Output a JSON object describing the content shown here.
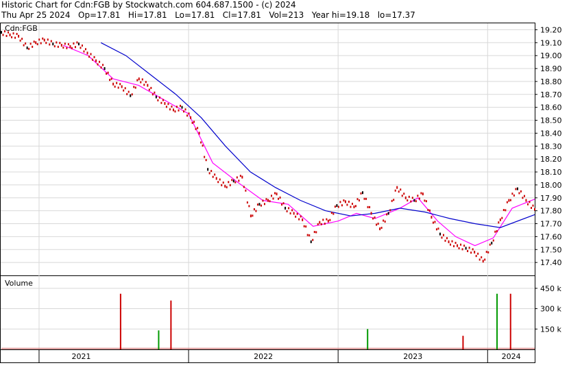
{
  "header": {
    "title": "Historic Chart for Cdn:FGB by Stockwatch.com 604.687.1500 - (c) 2024",
    "stats": "Thu Apr 25 2024   Op=17.81   Hi=17.81   Lo=17.81   Cl=17.81   Vol=213   Year hi=19.18   lo=17.37"
  },
  "chart_data": [
    {
      "type": "line",
      "subtype": "price-ohlc-with-moving-averages",
      "symbol_label": "Cdn:FGB",
      "y_axis_side": "right",
      "ylim": [
        17.3,
        19.25
      ],
      "yticks": [
        "19.20",
        "19.10",
        "19.00",
        "18.90",
        "18.80",
        "18.70",
        "18.60",
        "18.50",
        "18.40",
        "18.30",
        "18.20",
        "18.10",
        "18.00",
        "17.90",
        "17.80",
        "17.70",
        "17.60",
        "17.50",
        "17.40"
      ],
      "x_start": "2020-10-01",
      "x_end": "2024-04-25",
      "x_labels": [
        {
          "label": "2021",
          "date": "2021-01-01"
        },
        {
          "label": "2022",
          "date": "2022-01-01"
        },
        {
          "label": "2023",
          "date": "2023-01-01"
        },
        {
          "label": "2024",
          "date": "2024-01-01"
        }
      ],
      "grid": true,
      "colors": {
        "price": "#cc0000",
        "price_alt": "#000000",
        "ma_short": "#ff00ff",
        "ma_long": "#0000cc"
      },
      "series": [
        {
          "key": "price",
          "points": [
            [
              "2020-10-01",
              19.18
            ],
            [
              "2020-10-22",
              19.16
            ],
            [
              "2020-11-12",
              19.15
            ],
            [
              "2020-12-03",
              19.06
            ],
            [
              "2020-12-24",
              19.1
            ],
            [
              "2021-01-14",
              19.12
            ],
            [
              "2021-02-04",
              19.09
            ],
            [
              "2021-02-25",
              19.08
            ],
            [
              "2021-03-18",
              19.07
            ],
            [
              "2021-04-08",
              19.09
            ],
            [
              "2021-04-29",
              19.02
            ],
            [
              "2021-05-20",
              18.96
            ],
            [
              "2021-06-10",
              18.9
            ],
            [
              "2021-07-01",
              18.78
            ],
            [
              "2021-07-22",
              18.76
            ],
            [
              "2021-08-12",
              18.69
            ],
            [
              "2021-09-02",
              18.82
            ],
            [
              "2021-09-23",
              18.77
            ],
            [
              "2021-10-14",
              18.68
            ],
            [
              "2021-11-04",
              18.63
            ],
            [
              "2021-11-25",
              18.58
            ],
            [
              "2021-12-16",
              18.6
            ],
            [
              "2022-01-06",
              18.52
            ],
            [
              "2022-01-27",
              18.4
            ],
            [
              "2022-02-17",
              18.12
            ],
            [
              "2022-03-10",
              18.05
            ],
            [
              "2022-03-31",
              17.99
            ],
            [
              "2022-04-21",
              18.03
            ],
            [
              "2022-05-12",
              18.06
            ],
            [
              "2022-06-02",
              17.76
            ],
            [
              "2022-06-23",
              17.85
            ],
            [
              "2022-07-14",
              17.88
            ],
            [
              "2022-08-04",
              17.93
            ],
            [
              "2022-08-25",
              17.82
            ],
            [
              "2022-09-15",
              17.78
            ],
            [
              "2022-10-06",
              17.73
            ],
            [
              "2022-10-27",
              17.56
            ],
            [
              "2022-11-17",
              17.71
            ],
            [
              "2022-12-08",
              17.72
            ],
            [
              "2022-12-29",
              17.84
            ],
            [
              "2023-01-19",
              17.87
            ],
            [
              "2023-02-09",
              17.83
            ],
            [
              "2023-03-02",
              17.94
            ],
            [
              "2023-03-23",
              17.78
            ],
            [
              "2023-04-13",
              17.66
            ],
            [
              "2023-05-04",
              17.78
            ],
            [
              "2023-05-25",
              17.98
            ],
            [
              "2023-06-15",
              17.9
            ],
            [
              "2023-07-06",
              17.88
            ],
            [
              "2023-07-27",
              17.93
            ],
            [
              "2023-08-17",
              17.75
            ],
            [
              "2023-09-07",
              17.62
            ],
            [
              "2023-09-28",
              17.56
            ],
            [
              "2023-10-19",
              17.53
            ],
            [
              "2023-11-09",
              17.51
            ],
            [
              "2023-11-30",
              17.48
            ],
            [
              "2023-12-21",
              17.41
            ],
            [
              "2024-01-11",
              17.55
            ],
            [
              "2024-02-01",
              17.73
            ],
            [
              "2024-02-22",
              17.88
            ],
            [
              "2024-03-14",
              17.97
            ],
            [
              "2024-04-04",
              17.88
            ],
            [
              "2024-04-25",
              17.81
            ]
          ]
        },
        {
          "key": "ma_short",
          "points": [
            [
              "2021-03-01",
              19.08
            ],
            [
              "2021-05-01",
              19.0
            ],
            [
              "2021-07-01",
              18.82
            ],
            [
              "2021-09-01",
              18.77
            ],
            [
              "2021-11-01",
              18.66
            ],
            [
              "2022-01-01",
              18.55
            ],
            [
              "2022-03-01",
              18.17
            ],
            [
              "2022-05-01",
              18.02
            ],
            [
              "2022-07-01",
              17.88
            ],
            [
              "2022-09-01",
              17.85
            ],
            [
              "2022-11-01",
              17.68
            ],
            [
              "2023-01-01",
              17.72
            ],
            [
              "2023-02-15",
              17.78
            ],
            [
              "2023-04-01",
              17.74
            ],
            [
              "2023-06-01",
              17.82
            ],
            [
              "2023-07-15",
              17.9
            ],
            [
              "2023-09-01",
              17.72
            ],
            [
              "2023-10-15",
              17.6
            ],
            [
              "2023-12-01",
              17.53
            ],
            [
              "2024-01-15",
              17.59
            ],
            [
              "2024-03-01",
              17.82
            ],
            [
              "2024-04-25",
              17.89
            ]
          ]
        },
        {
          "key": "ma_long",
          "points": [
            [
              "2021-06-01",
              19.1
            ],
            [
              "2021-08-01",
              19.0
            ],
            [
              "2021-10-01",
              18.85
            ],
            [
              "2021-12-01",
              18.7
            ],
            [
              "2022-02-01",
              18.52
            ],
            [
              "2022-04-01",
              18.3
            ],
            [
              "2022-06-01",
              18.1
            ],
            [
              "2022-08-01",
              17.98
            ],
            [
              "2022-10-01",
              17.88
            ],
            [
              "2022-12-01",
              17.8
            ],
            [
              "2023-02-01",
              17.76
            ],
            [
              "2023-04-01",
              17.78
            ],
            [
              "2023-06-01",
              17.82
            ],
            [
              "2023-08-01",
              17.79
            ],
            [
              "2023-10-01",
              17.74
            ],
            [
              "2023-12-01",
              17.7
            ],
            [
              "2024-02-01",
              17.67
            ],
            [
              "2024-04-25",
              17.77
            ]
          ]
        }
      ]
    },
    {
      "type": "bar",
      "title": "Volume",
      "y_axis_side": "right",
      "ylim": [
        0,
        540000
      ],
      "yticks": [
        "450 k",
        "300 k",
        "150 k"
      ],
      "ytick_values": [
        450000,
        300000,
        150000
      ],
      "colors": {
        "up": "#009900",
        "down": "#cc0000",
        "flat": "#cc0000"
      },
      "baseline_volume": 12000,
      "spikes": [
        {
          "date": "2021-07-19",
          "volume": 410000,
          "color": "down"
        },
        {
          "date": "2021-10-20",
          "volume": 140000,
          "color": "up"
        },
        {
          "date": "2021-11-19",
          "volume": 360000,
          "color": "down"
        },
        {
          "date": "2023-03-14",
          "volume": 150000,
          "color": "up"
        },
        {
          "date": "2023-11-02",
          "volume": 100000,
          "color": "down"
        },
        {
          "date": "2024-01-24",
          "volume": 410000,
          "color": "up"
        },
        {
          "date": "2024-02-26",
          "volume": 410000,
          "color": "down"
        }
      ]
    }
  ]
}
